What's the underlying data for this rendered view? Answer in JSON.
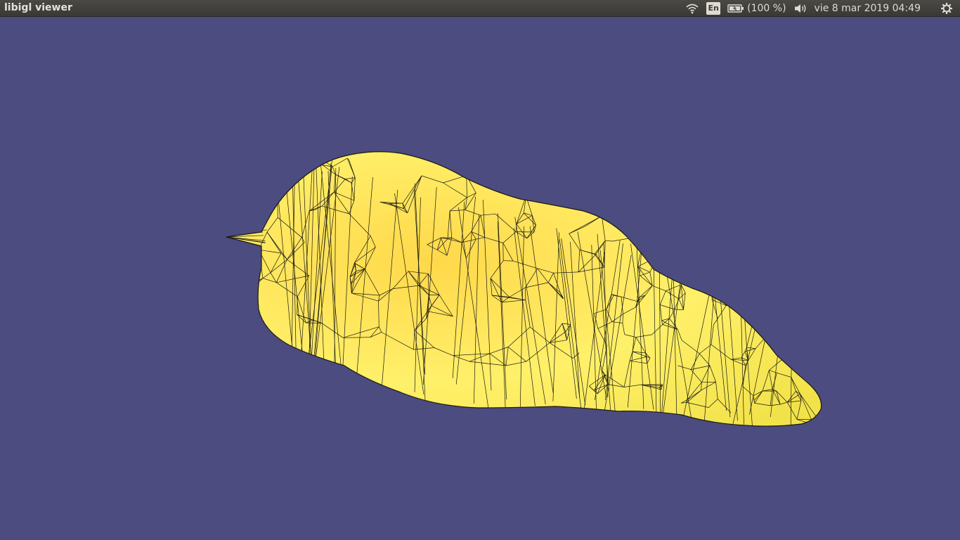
{
  "window": {
    "title": "libigl viewer"
  },
  "topbar": {
    "language": "En",
    "battery_text": "(100 %)",
    "clock_text": "vie  8 mar 2019 04:49"
  },
  "icons": {
    "wifi": "wifi-icon",
    "battery": "battery-icon",
    "volume": "volume-icon",
    "settings": "gear-icon"
  },
  "colors": {
    "background": "#4c4c80",
    "mesh_fill": "#ffe65a",
    "wireframe": "#1a1a10",
    "panel": "#3c3b37"
  }
}
